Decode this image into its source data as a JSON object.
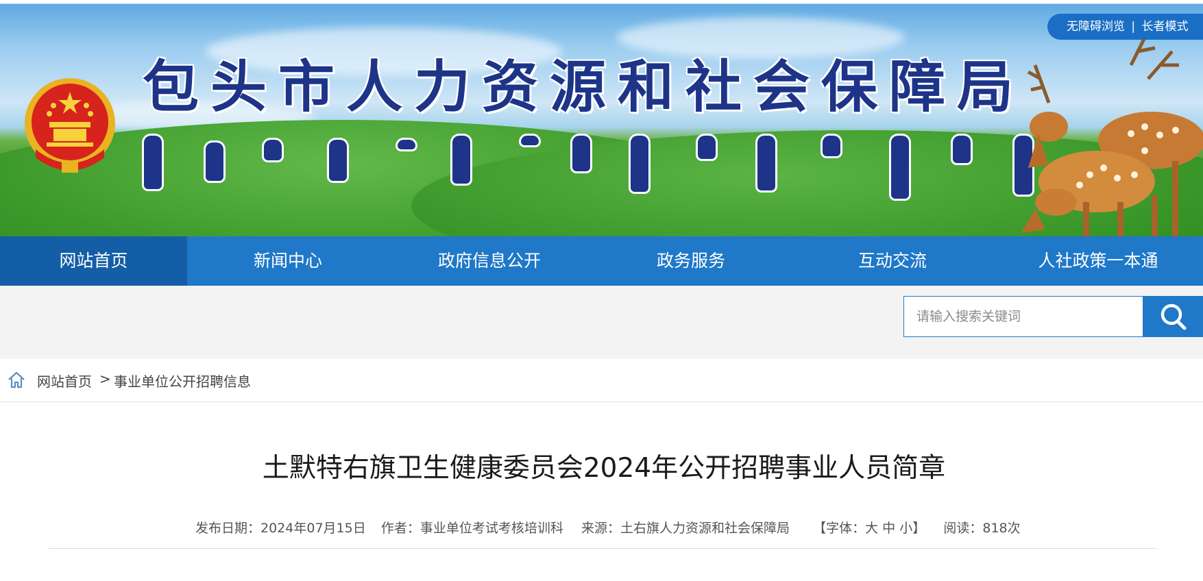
{
  "header": {
    "site_title": "包头市人力资源和社会保障局",
    "accessibility": {
      "barrier_free": "无障碍浏览",
      "separator": "|",
      "elder_mode": "长者模式"
    }
  },
  "nav": {
    "items": [
      {
        "label": "网站首页",
        "active": true
      },
      {
        "label": "新闻中心"
      },
      {
        "label": "政府信息公开"
      },
      {
        "label": "政务服务"
      },
      {
        "label": "互动交流"
      },
      {
        "label": "人社政策一本通"
      }
    ]
  },
  "search": {
    "placeholder": "请输入搜索关键词",
    "button_icon": "search-icon"
  },
  "breadcrumb": {
    "home_icon": "home-icon",
    "home": "网站首页",
    "separator": ">",
    "current": "事业单位公开招聘信息"
  },
  "article": {
    "title": "土默特右旗卫生健康委员会2024年公开招聘事业人员简章",
    "meta": {
      "date_label": "发布日期：",
      "date": "2024年07月15日",
      "author_label": "作者：",
      "author": "事业单位考试考核培训科",
      "source_label": "来源：",
      "source": "土右旗人力资源和社会保障局",
      "font_label_open": "【字体：",
      "font_large": "大",
      "font_medium": "中",
      "font_small": "小",
      "font_label_close": "】",
      "reads_label": "阅读：",
      "reads": "818次"
    }
  },
  "colors": {
    "nav_blue": "#1f78c8",
    "nav_active": "#135ea6",
    "title_blue": "#1d3488"
  }
}
